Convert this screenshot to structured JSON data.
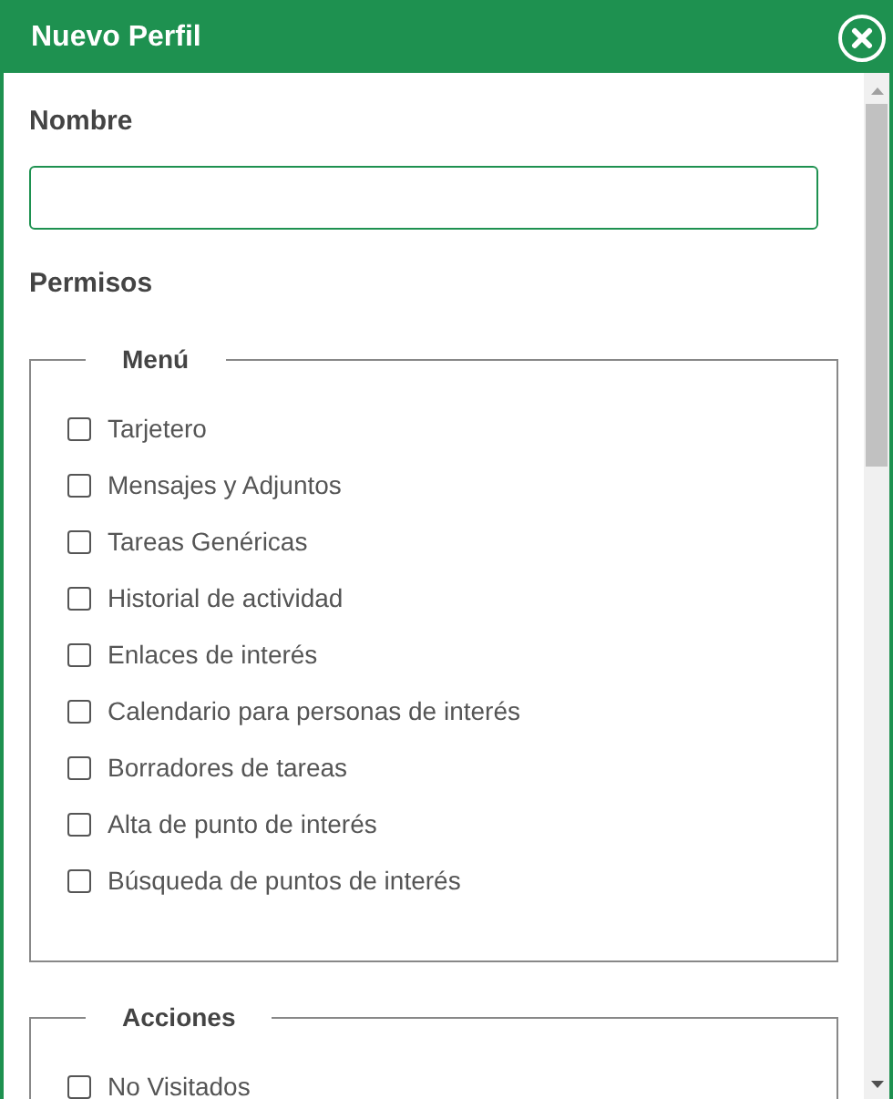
{
  "window": {
    "title": "Nuevo Perfil"
  },
  "name_field": {
    "label": "Nombre"
  },
  "permissions_label": "Permisos",
  "groups": [
    {
      "title": "Menú",
      "items": [
        {
          "label": "Tarjetero",
          "checked": false
        },
        {
          "label": "Mensajes y Adjuntos",
          "checked": false
        },
        {
          "label": "Tareas Genéricas",
          "checked": false
        },
        {
          "label": "Historial de actividad",
          "checked": false
        },
        {
          "label": "Enlaces de interés",
          "checked": false
        },
        {
          "label": "Calendario para personas de interés",
          "checked": false
        },
        {
          "label": "Borradores de tareas",
          "checked": false
        },
        {
          "label": "Alta de punto de interés",
          "checked": false
        },
        {
          "label": "Búsqueda de puntos de interés",
          "checked": false
        }
      ]
    },
    {
      "title": "Acciones",
      "items": [
        {
          "label": "No Visitados",
          "checked": false
        }
      ]
    }
  ]
}
